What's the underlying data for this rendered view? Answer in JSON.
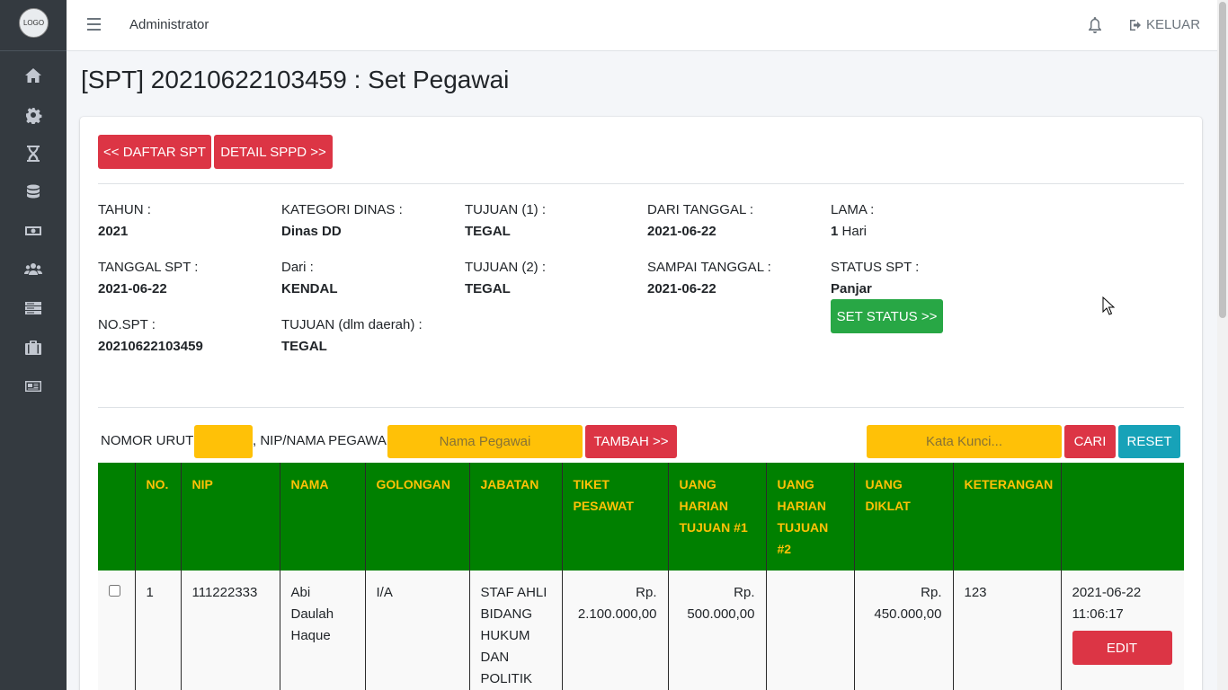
{
  "sidebar": {
    "logo_text": "LOGO",
    "items": [
      {
        "icon": "home-icon"
      },
      {
        "icon": "gear-icon"
      },
      {
        "icon": "hourglass-icon"
      },
      {
        "icon": "database-icon"
      },
      {
        "icon": "money-icon"
      },
      {
        "icon": "users-icon"
      },
      {
        "icon": "server-icon"
      },
      {
        "icon": "briefcase-icon"
      },
      {
        "icon": "newspaper-icon"
      }
    ]
  },
  "topbar": {
    "user": "Administrator",
    "logout_label": "KELUAR"
  },
  "page": {
    "title": "[SPT] 20210622103459 : Set Pegawai"
  },
  "actions": {
    "back_label": "<< DAFTAR SPT",
    "detail_label": "DETAIL SPPD >>"
  },
  "info": {
    "tahun_label": "TAHUN :",
    "tahun_value": "2021",
    "kategori_label": "KATEGORI DINAS :",
    "kategori_value": "Dinas DD",
    "tujuan1_label": "TUJUAN (1) :",
    "tujuan1_value": "TEGAL",
    "dari_tanggal_label": "DARI TANGGAL :",
    "dari_tanggal_value": "2021-06-22",
    "lama_label": "LAMA :",
    "lama_value": "1",
    "lama_unit": "Hari",
    "tanggal_spt_label": "TANGGAL SPT :",
    "tanggal_spt_value": "2021-06-22",
    "dari_label": "Dari :",
    "dari_value": "KENDAL",
    "tujuan2_label": "TUJUAN (2) :",
    "tujuan2_value": "TEGAL",
    "sampai_label": "SAMPAI TANGGAL :",
    "sampai_value": "2021-06-22",
    "status_label": "STATUS SPT :",
    "status_value": "Panjar",
    "set_status_label": "SET STATUS >>",
    "nospt_label": "NO.SPT :",
    "nospt_value": "20210622103459",
    "tujuan_dlm_label": "TUJUAN (dlm daerah) :",
    "tujuan_dlm_value": "TEGAL"
  },
  "form": {
    "nomor_urut_label": "NOMOR URUT :",
    "nomor_urut_value": "",
    "nip_label": ", NIP/NAMA PEGAWAI :",
    "nama_placeholder": "Nama Pegawai",
    "tambah_label": "TAMBAH >>",
    "search_placeholder": "Kata Kunci...",
    "cari_label": "CARI",
    "reset_label": "RESET"
  },
  "table": {
    "headers": [
      "",
      "NO.",
      "NIP",
      "NAMA",
      "GOLONGAN",
      "JABATAN",
      "TIKET PESAWAT",
      "UANG HARIAN TUJUAN #1",
      "UANG HARIAN TUJUAN #2",
      "UANG DIKLAT",
      "KETERANGAN",
      ""
    ],
    "rows": [
      {
        "no": "1",
        "nip": "111222333",
        "nama": "Abi Daulah Haque",
        "golongan": "I/A",
        "jabatan": "STAF AHLI BIDANG HUKUM DAN POLITIK",
        "tiket": "Rp. 2.100.000,00",
        "uh1": "Rp. 500.000,00",
        "uh2": "",
        "diklat": "Rp. 450.000,00",
        "keterangan": "123",
        "timestamp": "2021-06-22 11:06:17",
        "edit_label": "EDIT"
      }
    ]
  }
}
